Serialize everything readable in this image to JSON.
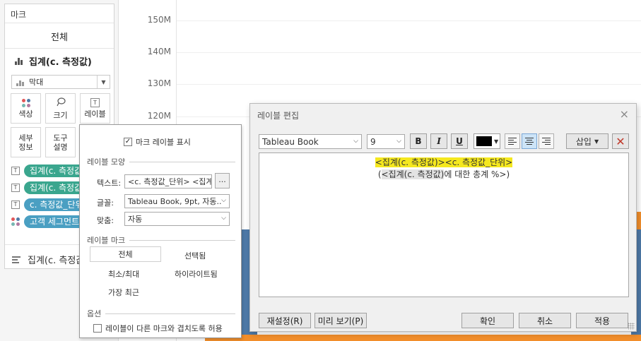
{
  "marks": {
    "title": "마크",
    "all": "전체",
    "aggregate": "집계(c. 측정값)",
    "mark_type": "막대",
    "buttons": {
      "color": "색상",
      "size": "크기",
      "label": "레이블",
      "detail": [
        "세부",
        "정보"
      ],
      "tooltip": [
        "도구",
        "설명"
      ]
    },
    "pills": [
      {
        "icon": "T",
        "text": "집계(c. 측정값)"
      },
      {
        "icon": "T",
        "text": "집계(c. 측정값)"
      },
      {
        "icon": "T",
        "text": "c. 측정값_단위"
      },
      {
        "icon": "dots",
        "text": "고객 세그먼트"
      }
    ],
    "bottom_aggregate": "집계(c. 측정값)"
  },
  "chart": {
    "ticks": [
      "150M",
      "140M",
      "130M",
      "120M"
    ],
    "colors": {
      "blue": "#4e79a7",
      "orange": "#f28e2b"
    }
  },
  "label_popup": {
    "show_labels": "마크 레이블 표시",
    "show_checked": true,
    "section_appearance": "레이블 모양",
    "text_label": "텍스트:",
    "text_value": "<c. 측정값_단위> <집계",
    "dots_button": "...",
    "font_label": "글꼴:",
    "font_value": "Tableau Book, 9pt, 자동..",
    "align_label": "맞춤:",
    "align_value": "자동",
    "section_marks": "레이블 마크",
    "mark_options": [
      "전체",
      "선택됨",
      "최소/최대",
      "하이라이트됨",
      "가장 최근"
    ],
    "section_options": "옵션",
    "overlap": "레이블이 다른 마크와 겹치도록 허용",
    "overlap_checked": false
  },
  "dialog": {
    "title": "레이블 편집",
    "close": "×",
    "font": "Tableau Book",
    "size": "9",
    "bold": "B",
    "italic": "I",
    "underline": "U",
    "insert": "삽입",
    "line1": "<집계(c. 측정값)><c. 측정값_단위>",
    "line2_open": "(",
    "line2_field": "<집계(c. 측정값)",
    "line2_rest": "에 대한 총계 %>)",
    "buttons": {
      "reset": "재설정(R)",
      "preview": "미리 보기(P)",
      "ok": "확인",
      "cancel": "취소",
      "apply": "적용"
    }
  }
}
